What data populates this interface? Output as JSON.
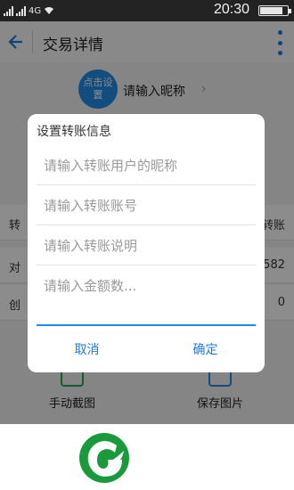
{
  "status_bar": {
    "time": "20:30",
    "network": "4G",
    "battery_fraction": 0.85
  },
  "app_bar": {
    "title": "交易详情",
    "back_icon": "back-arrow-icon",
    "menu_icon": "more-vert-icon"
  },
  "profile": {
    "avatar_text": "点击设置",
    "nickname": "请输入昵称"
  },
  "rows": [
    {
      "label": "转",
      "value": "转账"
    },
    {
      "label": "对",
      "value": "582"
    },
    {
      "label": "创",
      "value": "0"
    }
  ],
  "actions": {
    "screenshot_label": "手动截图",
    "save_label": "保存图片"
  },
  "dialog": {
    "title": "设置转账信息",
    "fields": [
      {
        "placeholder": "请输入转账用户的昵称",
        "value": ""
      },
      {
        "placeholder": "请输入转账账号",
        "value": ""
      },
      {
        "placeholder": "请输入转账说明",
        "value": ""
      },
      {
        "placeholder": "请输入金额数...",
        "value": ""
      }
    ],
    "cancel_label": "取消",
    "confirm_label": "确定"
  },
  "colors": {
    "accent": "#1f7ad6",
    "logo_green": "#1a9a3c",
    "status_bar": "#232323"
  }
}
